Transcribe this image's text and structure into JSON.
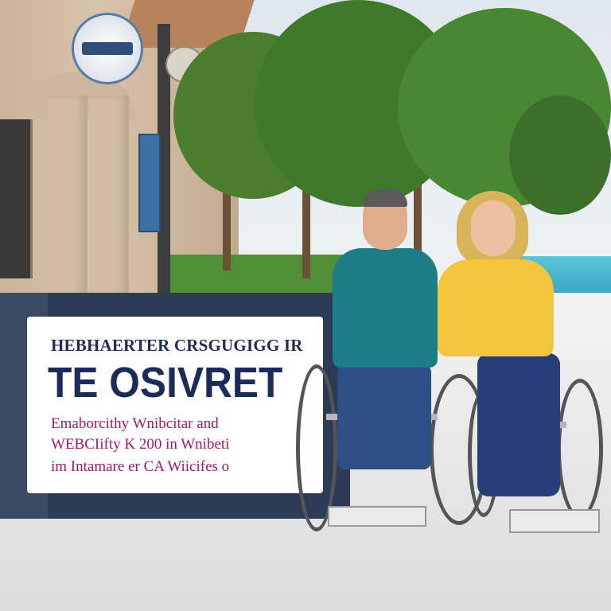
{
  "promo": {
    "line1": "HEBHAERTER CRSGUGIGG IR",
    "line2": "TE OSIVRET",
    "line3": "Emaborcithy Wnibcitar and",
    "line4": "WEBCIifty K 200 in Wnibeti",
    "line5": "im Intamare er CA Wiicifes o"
  },
  "colors": {
    "navy": "#2d3a55",
    "headline": "#1a2b5c",
    "body_text": "#a8166a",
    "card": "#ffffff"
  },
  "icons": {
    "logo": "circular-emblem-icon"
  }
}
